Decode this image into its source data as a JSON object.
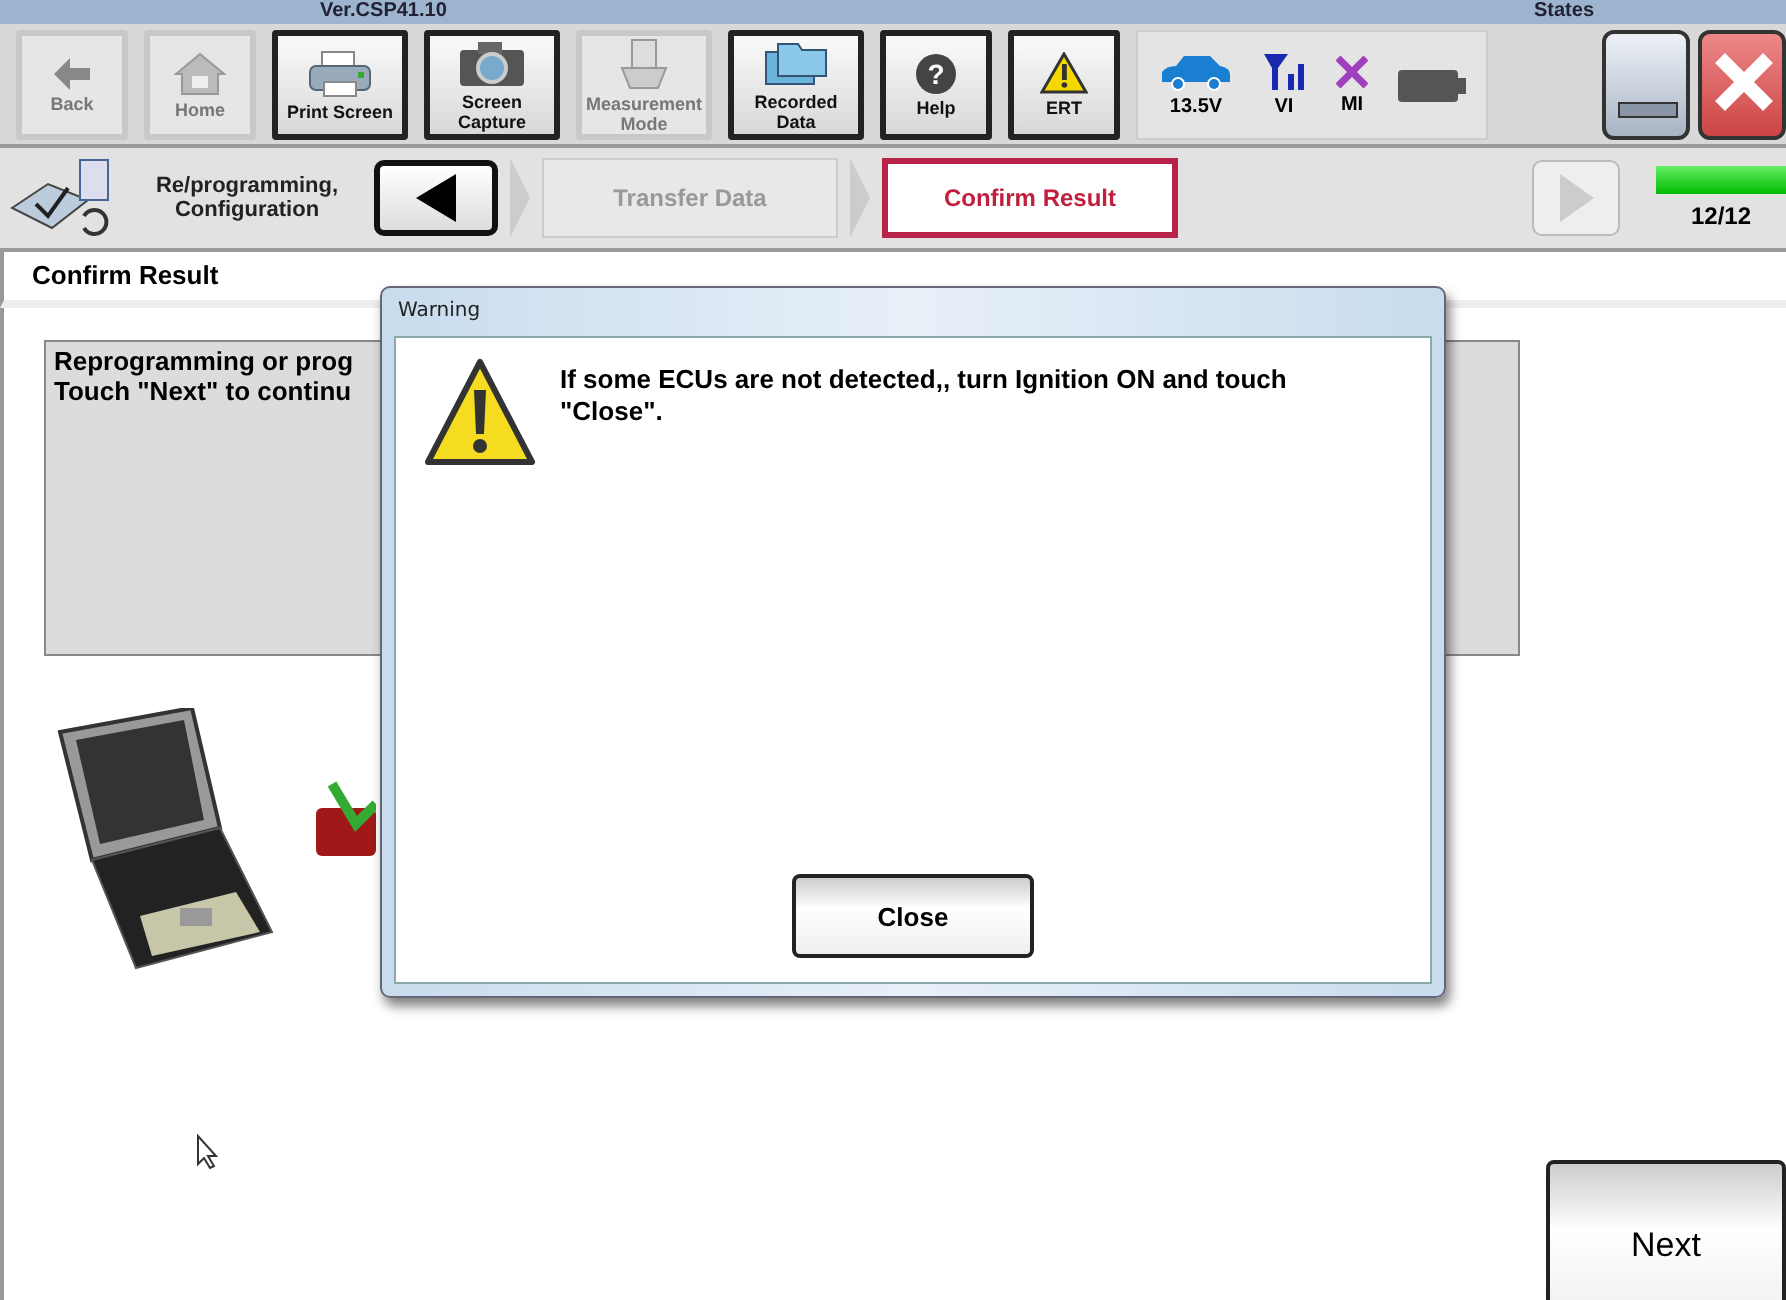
{
  "title_bar": {
    "version": "Ver.CSP41.10",
    "states_label": "States"
  },
  "toolbar": [
    {
      "label": "Back",
      "kind": "back",
      "disabled": true
    },
    {
      "label": "Home",
      "kind": "home",
      "disabled": true
    },
    {
      "label": "Print Screen",
      "kind": "printer",
      "disabled": false
    },
    {
      "label": "Screen Capture",
      "kind": "camera",
      "disabled": false
    },
    {
      "label": "Measurement Mode",
      "kind": "meter",
      "disabled": true
    },
    {
      "label": "Recorded Data",
      "kind": "folders",
      "disabled": false
    },
    {
      "label": "Help",
      "kind": "help",
      "disabled": false,
      "icon": "?"
    },
    {
      "label": "ERT",
      "kind": "warning",
      "disabled": false
    }
  ],
  "states": [
    {
      "label": "13.5V",
      "kind": "car"
    },
    {
      "label": "VI",
      "kind": "signal"
    },
    {
      "label": "MI",
      "kind": "cross"
    },
    {
      "kind": "battery"
    }
  ],
  "breadcrumb": {
    "title": "Re/programming, Configuration",
    "steps": [
      {
        "label": "Transfer Data",
        "selected": false
      },
      {
        "label": "Confirm Result",
        "selected": true
      }
    ],
    "next_disabled": true,
    "progress": {
      "level": 1,
      "reading": "12/12"
    }
  },
  "heading": "Confirm Result",
  "message_lines": [
    "Reprogramming or prog",
    "Touch \"Next\" to continu"
  ],
  "dialog": {
    "title": "Warning",
    "message": "If some ECUs are not detected,, turn Ignition ON and touch \"Close\".",
    "button": "Close"
  },
  "next_button": "Next"
}
